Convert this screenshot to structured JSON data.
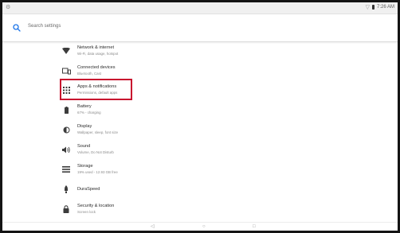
{
  "status_bar": {
    "left_icon": "android-notification-icon",
    "time": "7:26 AM",
    "icons": [
      "wifi-icon",
      "battery-icon"
    ]
  },
  "search": {
    "placeholder": "Search settings",
    "icon": "search-icon"
  },
  "settings_items": [
    {
      "id": "network",
      "title": "Network & internet",
      "subtitle": "Wi-Fi, data usage, hotspot",
      "icon": "wifi-icon"
    },
    {
      "id": "connected-devices",
      "title": "Connected devices",
      "subtitle": "Bluetooth, Cast",
      "icon": "devices-icon"
    },
    {
      "id": "apps",
      "title": "Apps & notifications",
      "subtitle": "Permissions, default apps",
      "icon": "apps-grid-icon",
      "highlighted": true
    },
    {
      "id": "battery",
      "title": "Battery",
      "subtitle": "67% - charging",
      "icon": "battery-icon"
    },
    {
      "id": "display",
      "title": "Display",
      "subtitle": "Wallpaper, sleep, font size",
      "icon": "brightness-icon"
    },
    {
      "id": "sound",
      "title": "Sound",
      "subtitle": "Volume, Do Not Disturb",
      "icon": "speaker-icon"
    },
    {
      "id": "storage",
      "title": "Storage",
      "subtitle": "19% used - 12.93 GB free",
      "icon": "storage-icon"
    },
    {
      "id": "duraspeed",
      "title": "DuraSpeed",
      "subtitle": "",
      "icon": "rocket-icon"
    },
    {
      "id": "security",
      "title": "Security & location",
      "subtitle": "Screen lock",
      "icon": "lock-icon"
    }
  ],
  "highlight_color": "#c8102e",
  "nav_bar": {
    "back": "◁",
    "home": "○",
    "recents": "□"
  }
}
